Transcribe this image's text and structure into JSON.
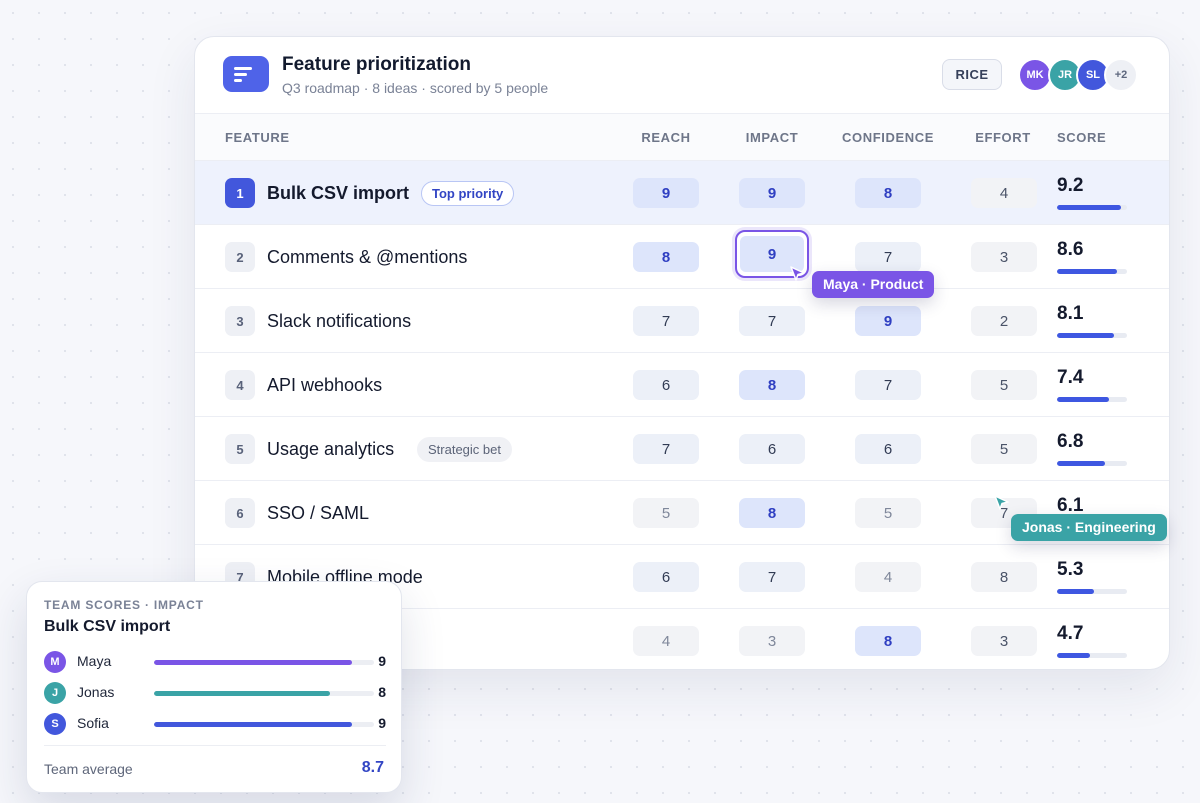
{
  "header": {
    "title": "Feature prioritization",
    "subtitle": "Q3 roadmap · 8 ideas · scored by 5 people",
    "method_label": "RICE",
    "avatars": [
      "MK",
      "JR",
      "SL"
    ],
    "more_count": "+2"
  },
  "columns": {
    "feature": "FEATURE",
    "reach": "REACH",
    "impact": "IMPACT",
    "confidence": "CONFIDENCE",
    "effort": "EFFORT",
    "score": "SCORE"
  },
  "rows": [
    {
      "rank": "1",
      "name": "Bulk CSV import",
      "tag": "Top priority",
      "reach": "9",
      "impact": "9",
      "confidence": "8",
      "effort": "4",
      "score": "9.2",
      "score_value": 9.2
    },
    {
      "rank": "2",
      "name": "Comments & @mentions",
      "reach": "8",
      "impact": "9",
      "confidence": "7",
      "effort": "3",
      "score": "8.6",
      "score_value": 8.6
    },
    {
      "rank": "3",
      "name": "Slack notifications",
      "reach": "7",
      "impact": "7",
      "confidence": "9",
      "effort": "2",
      "score": "8.1",
      "score_value": 8.1
    },
    {
      "rank": "4",
      "name": "API webhooks",
      "reach": "6",
      "impact": "8",
      "confidence": "7",
      "effort": "5",
      "score": "7.4",
      "score_value": 7.4
    },
    {
      "rank": "5",
      "name": "Usage analytics",
      "tag": "Strategic bet",
      "reach": "7",
      "impact": "6",
      "confidence": "6",
      "effort": "5",
      "score": "6.8",
      "score_value": 6.8
    },
    {
      "rank": "6",
      "name": "SSO / SAML",
      "reach": "5",
      "impact": "8",
      "confidence": "5",
      "effort": "7",
      "score": "6.1",
      "score_value": 6.1
    },
    {
      "rank": "7",
      "name": "Mobile offline mode",
      "reach": "6",
      "impact": "7",
      "confidence": "4",
      "effort": "8",
      "score": "5.3",
      "score_value": 5.3
    },
    {
      "rank": "",
      "name": "",
      "reach": "4",
      "impact": "3",
      "confidence": "8",
      "effort": "3",
      "score": "4.7",
      "score_value": 4.7
    }
  ],
  "cursors": {
    "maya": "Maya · Product",
    "jonas": "Jonas · Engineering"
  },
  "team_scores": {
    "label": "TEAM SCORES · IMPACT",
    "feature": "Bulk CSV import",
    "members": [
      {
        "initial": "M",
        "name": "Maya",
        "score": "9",
        "value": 9
      },
      {
        "initial": "J",
        "name": "Jonas",
        "score": "8",
        "value": 8
      },
      {
        "initial": "S",
        "name": "Sofia",
        "score": "9",
        "value": 9
      }
    ],
    "average_label": "Team average",
    "average_value": "8.7"
  },
  "colors": {
    "accent": "#4257dc",
    "maya": "#7a55e6",
    "jonas": "#3aa3a6",
    "sofia": "#4257dc",
    "score_bar": "#3e57e1"
  }
}
